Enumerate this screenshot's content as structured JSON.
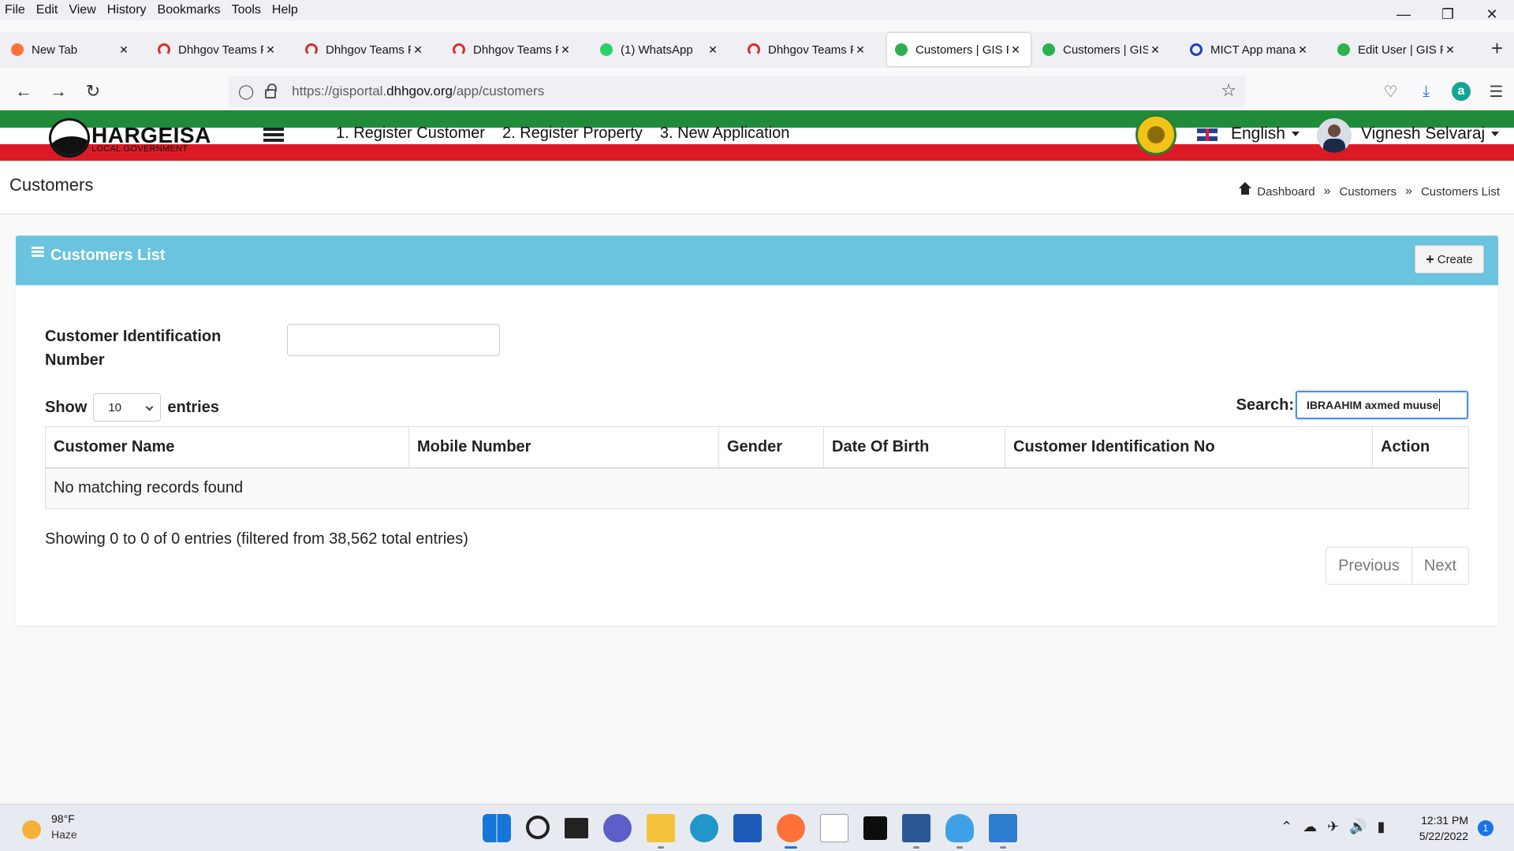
{
  "menubar": {
    "items": [
      "File",
      "Edit",
      "View",
      "History",
      "Bookmarks",
      "Tools",
      "Help"
    ]
  },
  "tabs": [
    {
      "title": "New Tab",
      "icon": "firefox-icon",
      "color": "#ff7139"
    },
    {
      "title": "Dhhgov Teams Po",
      "icon": "teams-arc-icon",
      "color": "#d32f2f"
    },
    {
      "title": "Dhhgov Teams Po",
      "icon": "teams-arc-icon",
      "color": "#d32f2f"
    },
    {
      "title": "Dhhgov Teams Po",
      "icon": "teams-arc-icon",
      "color": "#d32f2f"
    },
    {
      "title": "(1) WhatsApp",
      "icon": "whatsapp-icon",
      "color": "#25d366"
    },
    {
      "title": "Dhhgov Teams Po",
      "icon": "teams-arc-icon",
      "color": "#d32f2f"
    },
    {
      "title": "Customers | GIS P",
      "icon": "gis-icon",
      "color": "#2bb24c",
      "active": true
    },
    {
      "title": "Customers | GIS P",
      "icon": "gis-icon",
      "color": "#2bb24c"
    },
    {
      "title": "MICT App manag",
      "icon": "mict-icon",
      "color": "#1e3fbf"
    },
    {
      "title": "Edit User | GIS Po",
      "icon": "gis-icon",
      "color": "#2bb24c"
    }
  ],
  "url": {
    "prefix": "https://gisportal.",
    "domain": "dhhgov.org",
    "path": "/app/customers"
  },
  "header": {
    "logo_text": "HARGEISA",
    "logo_sub": "LOCAL GOVERNMENT",
    "nav": [
      "1. Register Customer",
      "2. Register Property",
      "3. New Application"
    ],
    "language": "English",
    "user": "Vignesh Selvaraj"
  },
  "page": {
    "title": "Customers",
    "breadcrumb": [
      "Dashboard",
      "Customers",
      "Customers List"
    ]
  },
  "panel": {
    "title": "Customers List",
    "create_label": "Create",
    "cid_label": "Customer Identification Number",
    "show_label": "Show",
    "entries_label": "entries",
    "page_size": "10",
    "search_label": "Search:",
    "search_value": "IBRAAHIM axmed muuse",
    "columns": [
      "Customer Name",
      "Mobile Number",
      "Gender",
      "Date Of Birth",
      "Customer Identification No",
      "Action"
    ],
    "empty_text": "No matching records found",
    "info": "Showing 0 to 0 of 0 entries (filtered from 38,562 total entries)",
    "prev_label": "Previous",
    "next_label": "Next"
  },
  "colors": {
    "header_green": "#1f8b3b",
    "header_red": "#dc1a25",
    "panel_head": "#6ac3df"
  },
  "taskbar": {
    "temperature": "98°F",
    "weather": "Haze",
    "time": "12:31 PM",
    "date": "5/22/2022",
    "notifications": "1",
    "apps": [
      "windows-start-icon",
      "search-icon",
      "task-view-icon",
      "chat-icon",
      "file-explorer-icon",
      "edge-icon",
      "store-icon",
      "firefox-icon",
      "amazon-icon",
      "dropbox-icon",
      "word-icon",
      "lightbulb-icon",
      "photos-icon"
    ]
  }
}
